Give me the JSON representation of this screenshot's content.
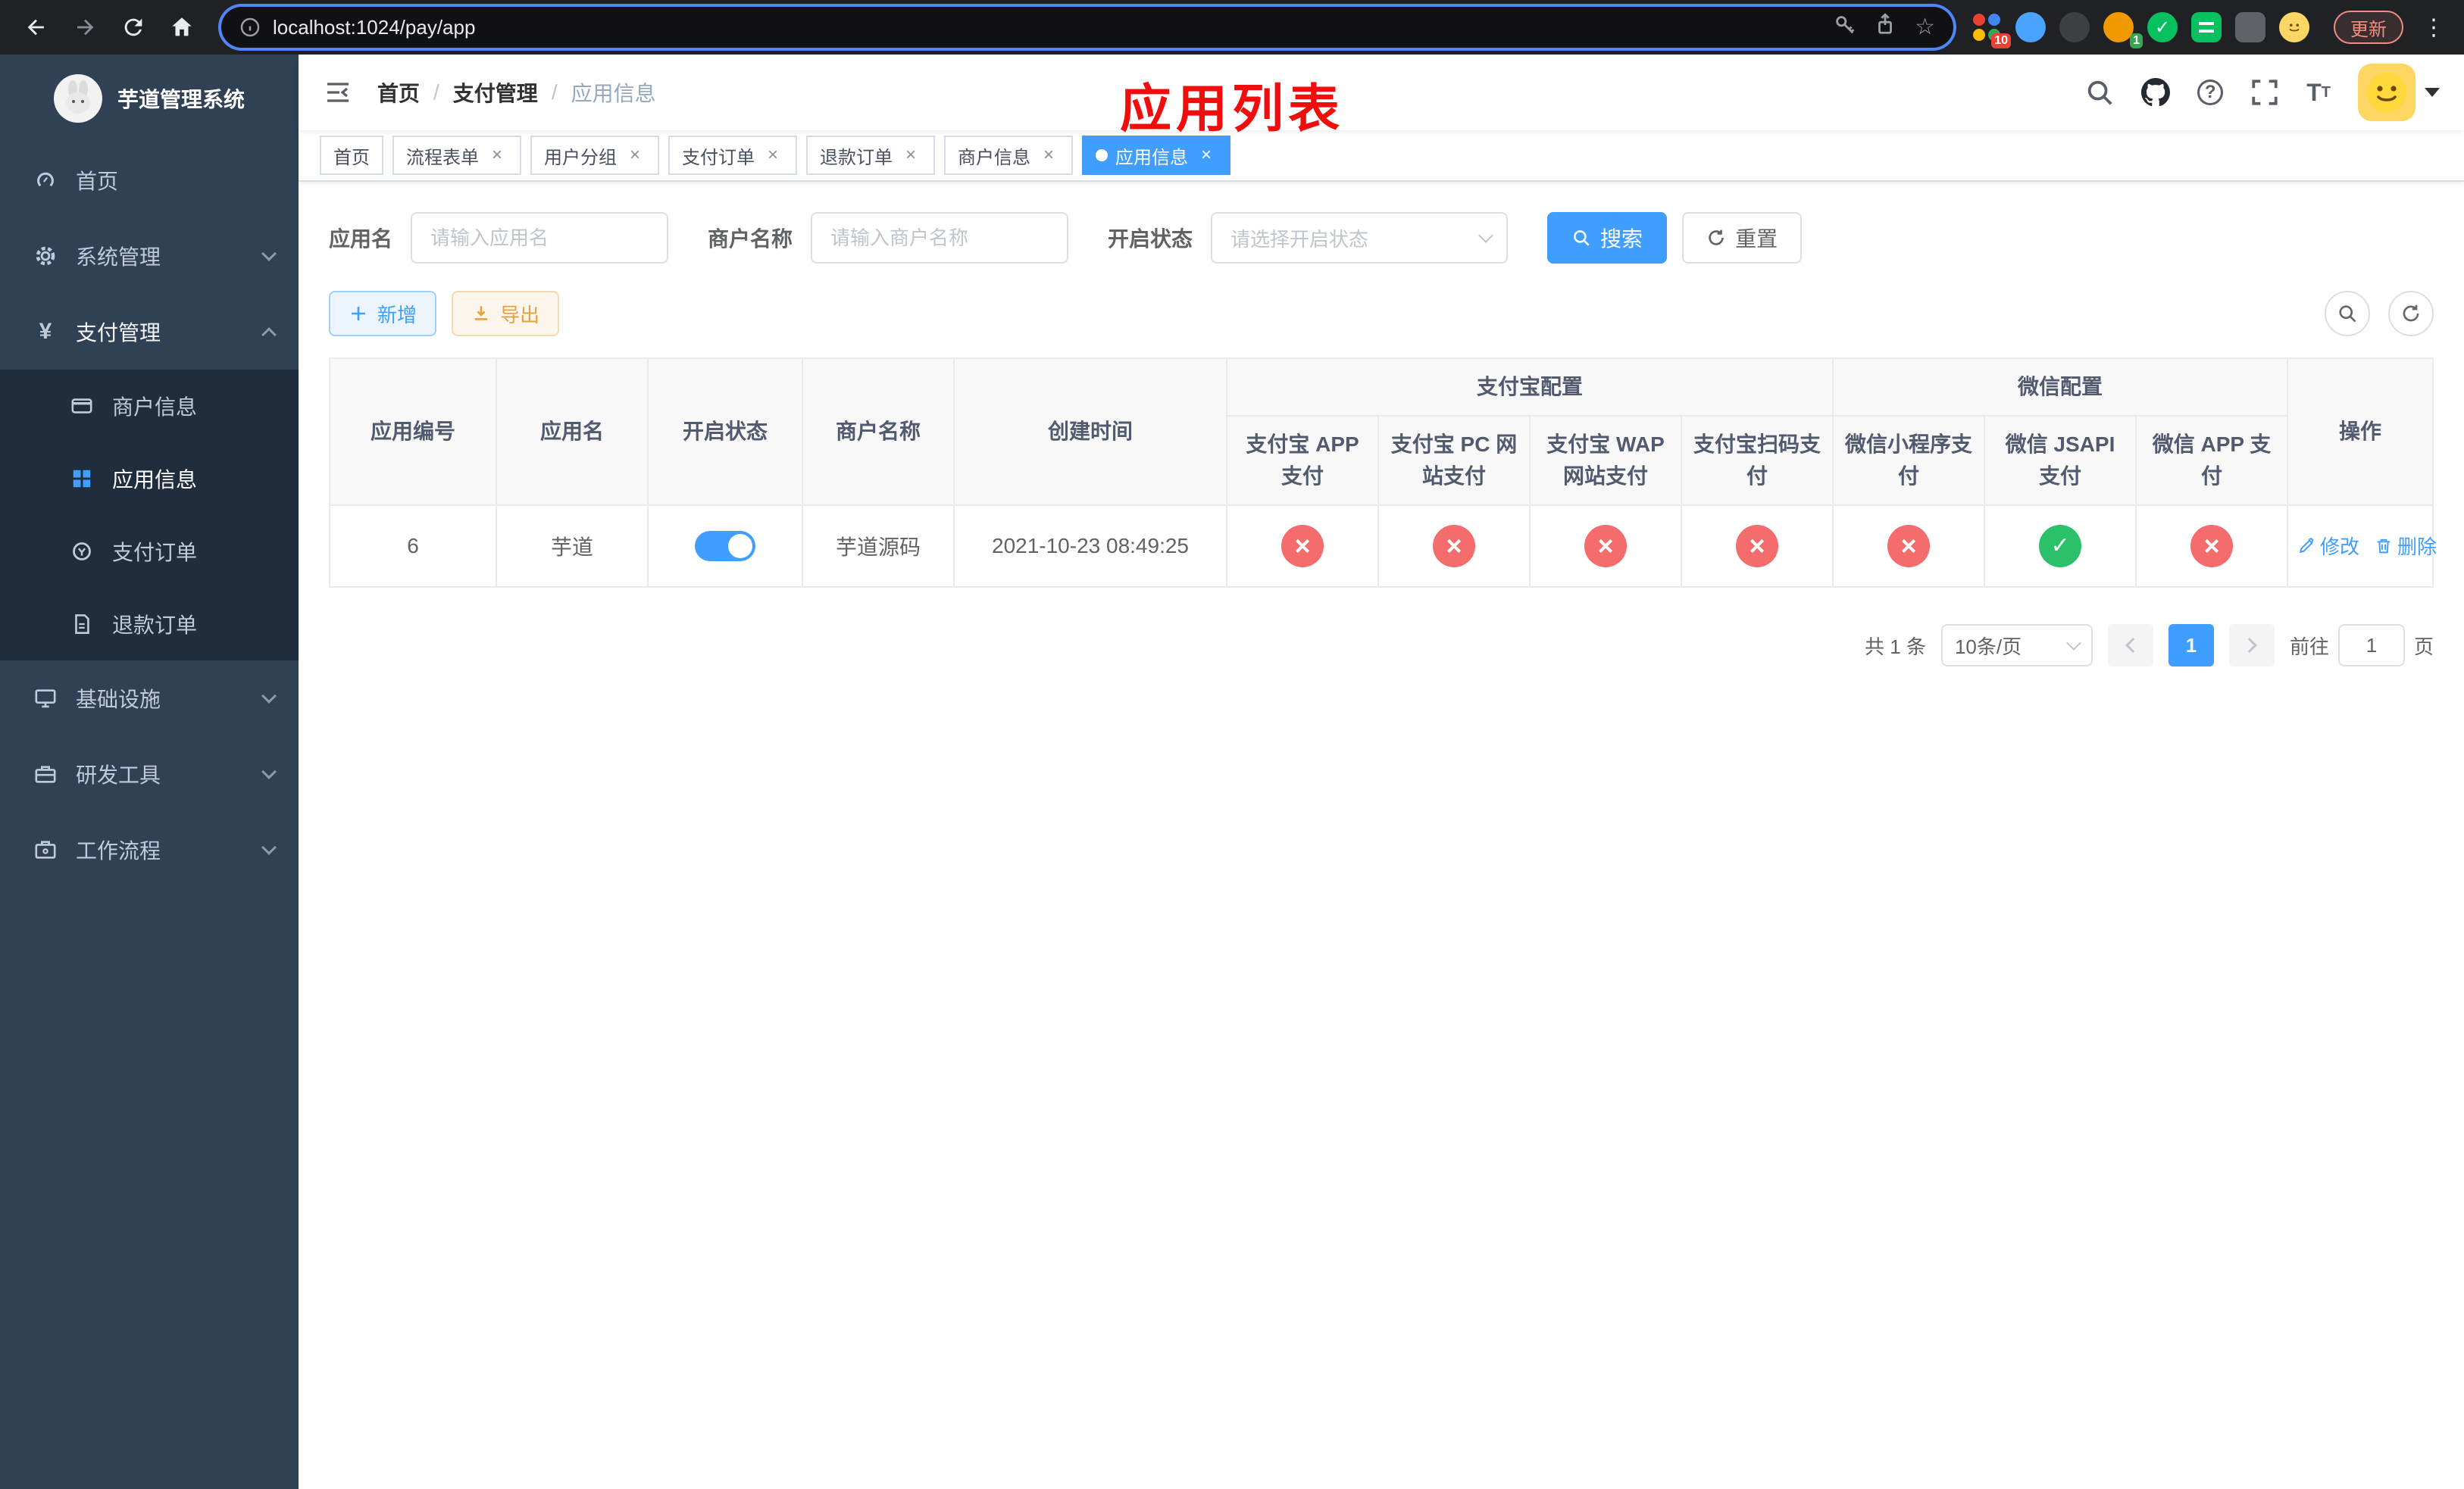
{
  "browser": {
    "url": "localhost:1024/pay/app",
    "update_label": "更新",
    "grid_badge": "10",
    "avatar_badge": "1"
  },
  "annotation": "应用列表",
  "sidebar": {
    "title": "芋道管理系统",
    "menu": [
      {
        "label": "首页"
      },
      {
        "label": "系统管理"
      },
      {
        "label": "支付管理"
      },
      {
        "label": "基础设施"
      },
      {
        "label": "研发工具"
      },
      {
        "label": "工作流程"
      }
    ],
    "submenu": [
      {
        "label": "商户信息"
      },
      {
        "label": "应用信息"
      },
      {
        "label": "支付订单"
      },
      {
        "label": "退款订单"
      }
    ]
  },
  "breadcrumb": {
    "items": [
      "首页",
      "支付管理",
      "应用信息"
    ],
    "separator": "/"
  },
  "tabs": [
    {
      "label": "首页"
    },
    {
      "label": "流程表单"
    },
    {
      "label": "用户分组"
    },
    {
      "label": "支付订单"
    },
    {
      "label": "退款订单"
    },
    {
      "label": "商户信息"
    },
    {
      "label": "应用信息"
    }
  ],
  "icons": {
    "close": "×"
  },
  "filters": {
    "app_name": {
      "label": "应用名",
      "placeholder": "请输入应用名"
    },
    "merchant": {
      "label": "商户名称",
      "placeholder": "请输入商户名称"
    },
    "status": {
      "label": "开启状态",
      "placeholder": "请选择开启状态"
    },
    "search": "搜索",
    "reset": "重置"
  },
  "toolbar": {
    "add": "新增",
    "export": "导出"
  },
  "table": {
    "groups": {
      "alipay": "支付宝配置",
      "wechat": "微信配置"
    },
    "columns": {
      "id": "应用编号",
      "name": "应用名",
      "status": "开启状态",
      "merchant": "商户名称",
      "created": "创建时间",
      "alipay_app": "支付宝 APP 支付",
      "alipay_pc": "支付宝 PC 网站支付",
      "alipay_wap": "支付宝 WAP 网站支付",
      "alipay_qr": "支付宝扫码支付",
      "wx_mini": "微信小程序支付",
      "wx_jsapi": "微信 JSAPI 支付",
      "wx_app": "微信 APP 支付",
      "ops": "操作"
    },
    "row": {
      "id": "6",
      "name": "芋道",
      "status": "on",
      "merchant": "芋道源码",
      "created": "2021-10-23 08:49:25",
      "alipay_app": "off",
      "alipay_pc": "off",
      "alipay_wap": "off",
      "alipay_qr": "off",
      "wx_mini": "off",
      "wx_jsapi": "on",
      "wx_app": "off",
      "edit": "修改",
      "delete": "删除"
    }
  },
  "pagination": {
    "total": "共 1 条",
    "page_size": "10条/页",
    "page": "1",
    "goto_prefix": "前往",
    "goto_value": "1",
    "goto_suffix": "页"
  },
  "colors": {
    "primary": "#409eff",
    "danger": "#f56c6c",
    "success": "#2bc06a",
    "warning": "#e6a23c",
    "sidebar_bg": "#304156",
    "submenu_bg": "#1f2d3d",
    "annotation": "#f20d0d"
  }
}
